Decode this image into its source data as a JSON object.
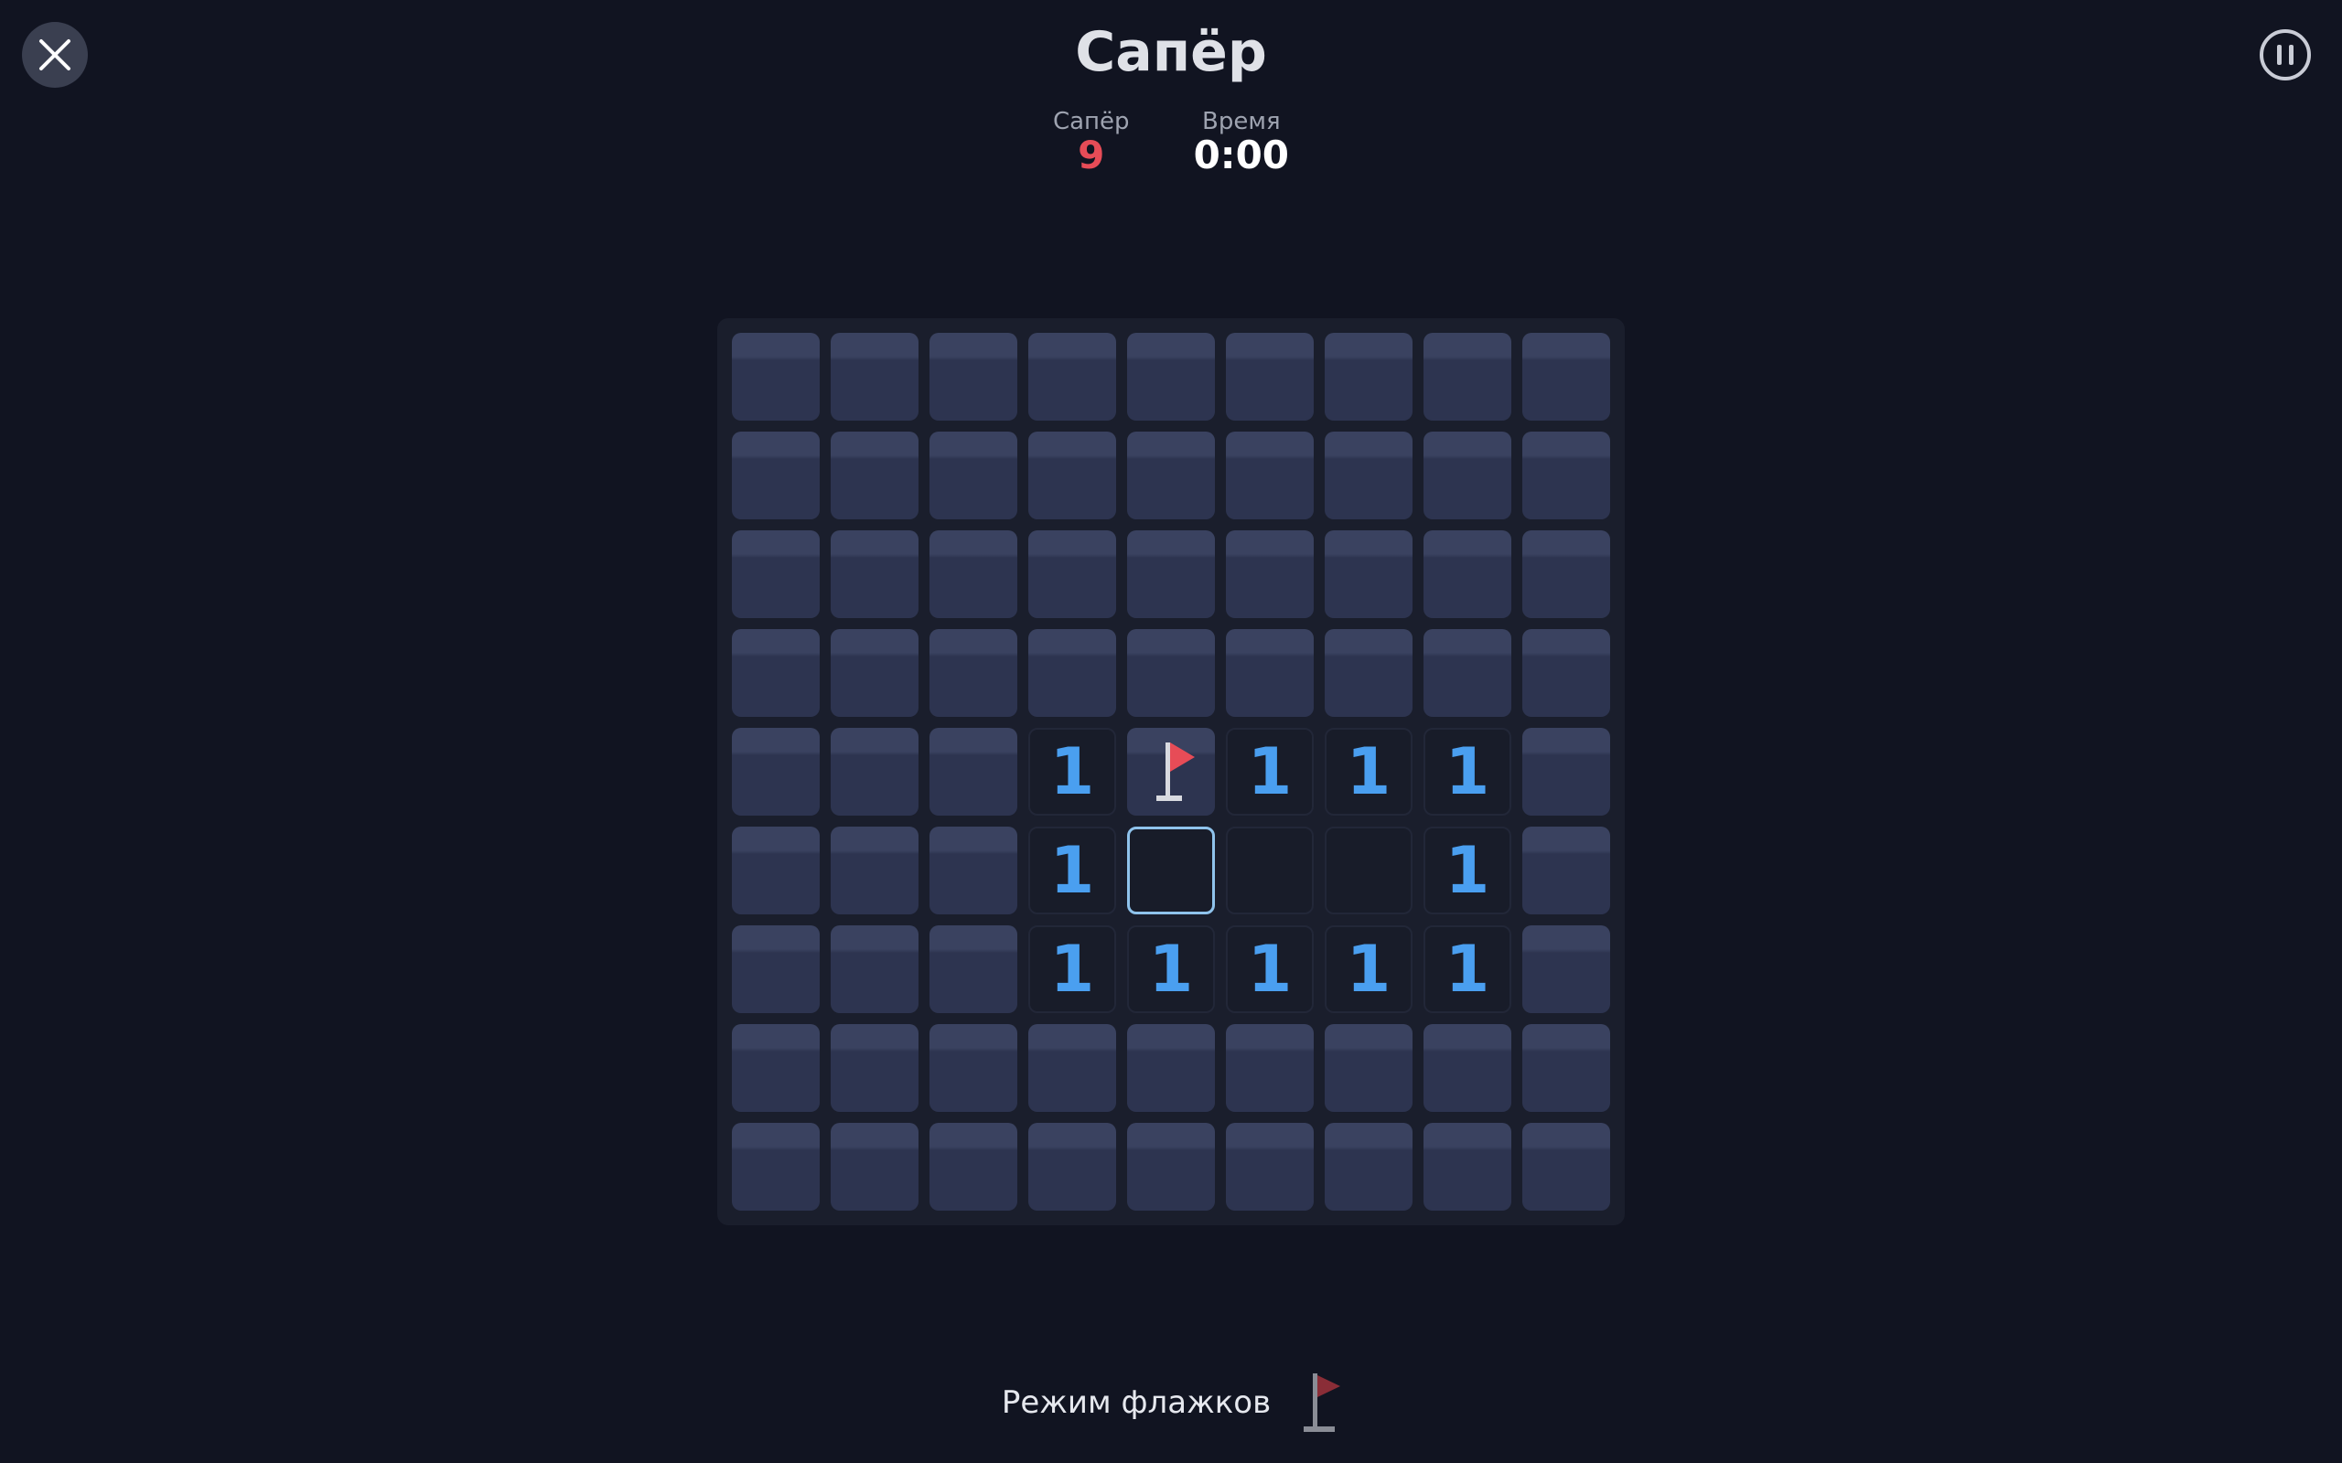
{
  "game": {
    "title": "Сапёр"
  },
  "stats": {
    "mines_label": "Сапёр",
    "mines_value": "9",
    "time_label": "Время",
    "time_value": "0:00"
  },
  "board": {
    "rows": [
      [
        "c",
        "c",
        "c",
        "c",
        "c",
        "c",
        "c",
        "c",
        "c"
      ],
      [
        "c",
        "c",
        "c",
        "c",
        "c",
        "c",
        "c",
        "c",
        "c"
      ],
      [
        "c",
        "c",
        "c",
        "c",
        "c",
        "c",
        "c",
        "c",
        "c"
      ],
      [
        "c",
        "c",
        "c",
        "c",
        "c",
        "c",
        "c",
        "c",
        "c"
      ],
      [
        "c",
        "c",
        "c",
        "1",
        "F",
        "1",
        "1",
        "1",
        "c"
      ],
      [
        "c",
        "c",
        "c",
        "1",
        "0",
        "0",
        "0",
        "1",
        "c"
      ],
      [
        "c",
        "c",
        "c",
        "1",
        "1",
        "1",
        "1",
        "1",
        "c"
      ],
      [
        "c",
        "c",
        "c",
        "c",
        "c",
        "c",
        "c",
        "c",
        "c"
      ],
      [
        "c",
        "c",
        "c",
        "c",
        "c",
        "c",
        "c",
        "c",
        "c"
      ]
    ],
    "selected_cell": {
      "row": 5,
      "col": 4
    },
    "legend": {
      "c": "covered",
      "F": "flagged",
      "0": "revealed-empty"
    }
  },
  "footer": {
    "flag_mode_label": "Режим флажков",
    "flag_mode_active": false
  },
  "colors": {
    "number_1": "#4a9ff0",
    "flag": "#e74c57",
    "mine_counter": "#e74c57",
    "selection": "#8fc3ec"
  },
  "icons": {
    "close": "close-icon",
    "pause": "pause-icon",
    "flag": "flag-icon"
  }
}
